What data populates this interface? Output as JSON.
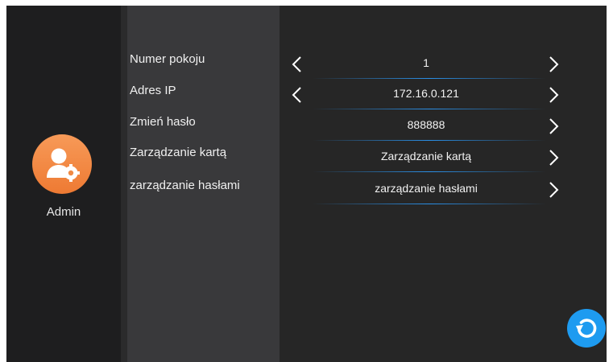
{
  "user": {
    "name": "Admin",
    "icon": "admin-user-gear-icon"
  },
  "menu": {
    "items": [
      {
        "label": "Numer pokoju"
      },
      {
        "label": "Adres IP"
      },
      {
        "label": "Zmień hasło"
      },
      {
        "label": "Zarządzanie kartą"
      },
      {
        "label": "zarządzanie hasłami"
      }
    ]
  },
  "values": {
    "rows": [
      {
        "value": "1",
        "left_arrow": true,
        "right_arrow": true
      },
      {
        "value": "172.16.0.121",
        "left_arrow": true,
        "right_arrow": true
      },
      {
        "value": "888888",
        "left_arrow": false,
        "right_arrow": true
      },
      {
        "value": "Zarządzanie kartą",
        "left_arrow": false,
        "right_arrow": true
      },
      {
        "value": "zarządzanie hasłami",
        "left_arrow": false,
        "right_arrow": true
      }
    ]
  },
  "controls": {
    "refresh_icon": "refresh-icon"
  },
  "colors": {
    "background": "#262626",
    "left_panel": "#1e1e1f",
    "menu_panel": "#39393b",
    "accent_blue": "#1e9bf0",
    "avatar_orange": "#f08a45"
  }
}
